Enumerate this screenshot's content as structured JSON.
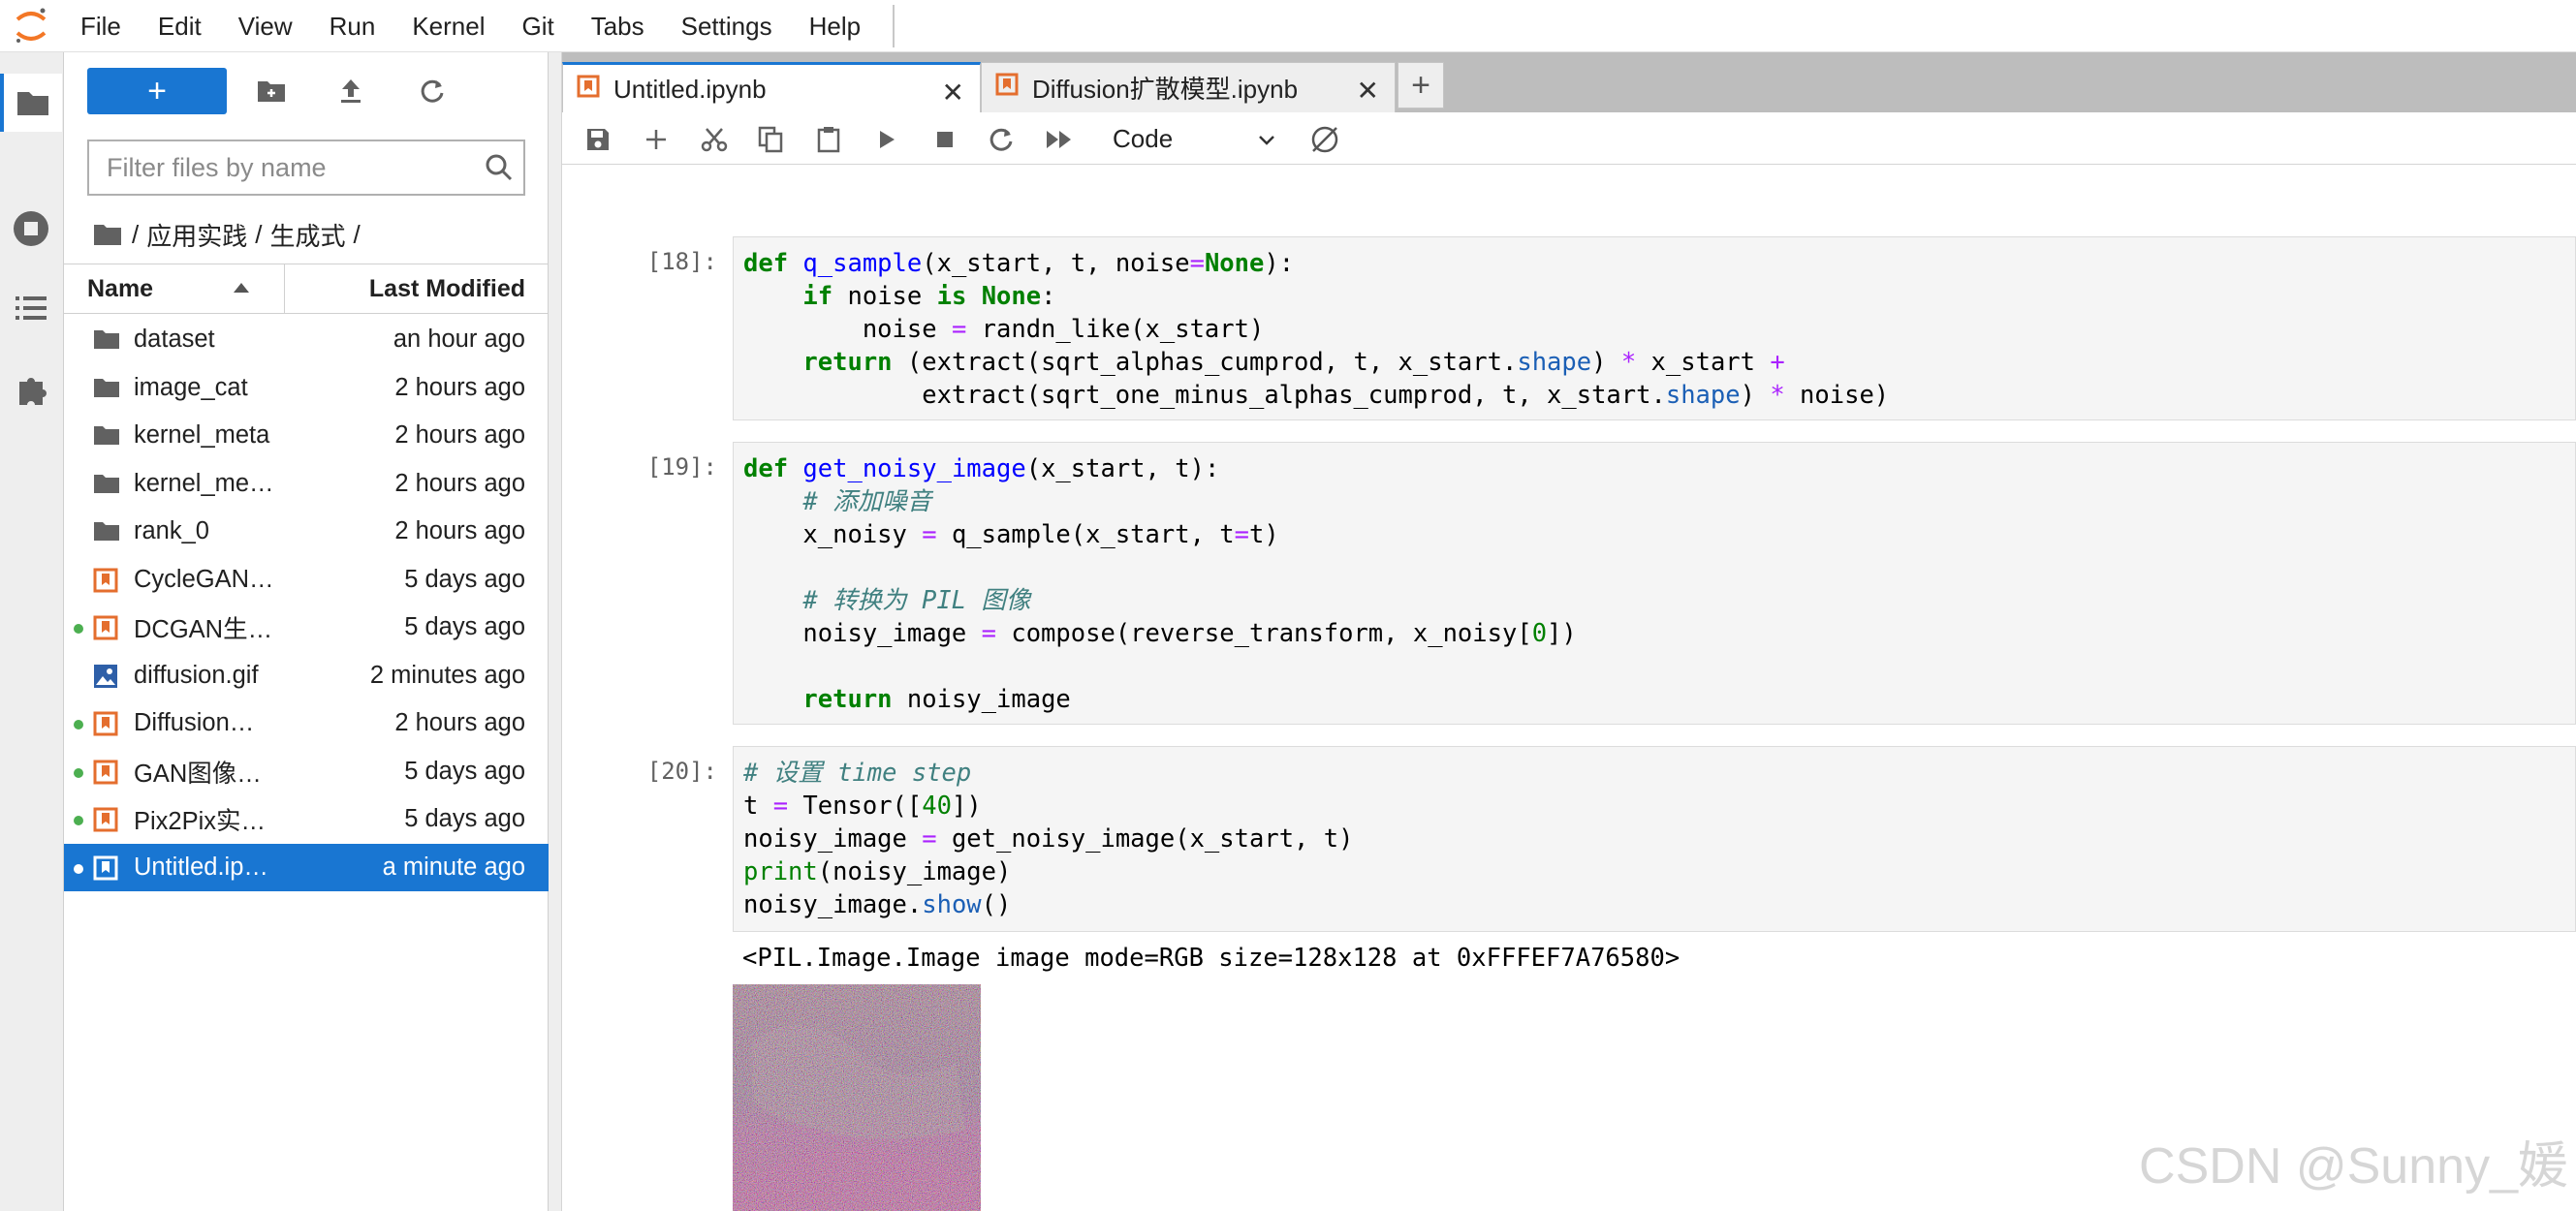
{
  "menubar": {
    "items": [
      "File",
      "Edit",
      "View",
      "Run",
      "Kernel",
      "Git",
      "Tabs",
      "Settings",
      "Help"
    ]
  },
  "activity_bar": {
    "icons": [
      "folder-icon",
      "running-icon",
      "toc-icon",
      "extension-icon"
    ]
  },
  "filebrowser": {
    "new_label": "+",
    "filter_placeholder": "Filter files by name",
    "filter_value": "",
    "breadcrumb": [
      "/",
      "应用实践",
      "/",
      "生成式",
      "/"
    ],
    "columns": {
      "name": "Name",
      "modified": "Last Modified"
    },
    "files": [
      {
        "name": "dataset",
        "modified": "an hour ago",
        "type": "folder",
        "running": false,
        "selected": false
      },
      {
        "name": "image_cat",
        "modified": "2 hours ago",
        "type": "folder",
        "running": false,
        "selected": false
      },
      {
        "name": "kernel_meta",
        "modified": "2 hours ago",
        "type": "folder",
        "running": false,
        "selected": false
      },
      {
        "name": "kernel_me…",
        "modified": "2 hours ago",
        "type": "folder",
        "running": false,
        "selected": false
      },
      {
        "name": "rank_0",
        "modified": "2 hours ago",
        "type": "folder",
        "running": false,
        "selected": false
      },
      {
        "name": "CycleGAN…",
        "modified": "5 days ago",
        "type": "notebook",
        "running": false,
        "selected": false
      },
      {
        "name": "DCGAN生…",
        "modified": "5 days ago",
        "type": "notebook",
        "running": true,
        "selected": false
      },
      {
        "name": "diffusion.gif",
        "modified": "2 minutes ago",
        "type": "image",
        "running": false,
        "selected": false
      },
      {
        "name": "Diffusion…",
        "modified": "2 hours ago",
        "type": "notebook",
        "running": true,
        "selected": false
      },
      {
        "name": "GAN图像…",
        "modified": "5 days ago",
        "type": "notebook",
        "running": true,
        "selected": false
      },
      {
        "name": "Pix2Pix实…",
        "modified": "5 days ago",
        "type": "notebook",
        "running": true,
        "selected": false
      },
      {
        "name": "Untitled.ip…",
        "modified": "a minute ago",
        "type": "notebook",
        "running": true,
        "selected": true
      }
    ]
  },
  "tabs": [
    {
      "label": "Untitled.ipynb",
      "active": true
    },
    {
      "label": "Diffusion扩散模型.ipynb",
      "active": false
    }
  ],
  "toolbar": {
    "cell_type": "Code",
    "buttons": [
      "save-icon",
      "add-cell-icon",
      "cut-icon",
      "copy-icon",
      "paste-icon",
      "run-icon",
      "stop-icon",
      "restart-icon",
      "fast-forward-icon"
    ]
  },
  "cells": [
    {
      "prompt": "[18]:",
      "lines": [
        "def q_sample(x_start, t, noise=None):",
        "    if noise is None:",
        "        noise = randn_like(x_start)",
        "    return (extract(sqrt_alphas_cumprod, t, x_start.shape) * x_start +",
        "            extract(sqrt_one_minus_alphas_cumprod, t, x_start.shape) * noise)"
      ]
    },
    {
      "prompt": "[19]:",
      "lines": [
        "def get_noisy_image(x_start, t):",
        "    # 添加噪音",
        "    x_noisy = q_sample(x_start, t=t)",
        "",
        "    # 转换为 PIL 图像",
        "    noisy_image = compose(reverse_transform, x_noisy[0])",
        "",
        "    return noisy_image"
      ]
    },
    {
      "prompt": "[20]:",
      "lines": [
        "# 设置 time step",
        "t = Tensor([40])",
        "noisy_image = get_noisy_image(x_start, t)",
        "print(noisy_image)",
        "noisy_image.show()"
      ],
      "output_text": "<PIL.Image.Image image mode=RGB size=128x128 at 0xFFFEF7A76580>"
    }
  ],
  "watermark": "CSDN @Sunny_媛",
  "colors": {
    "accent": "#1976d2",
    "running_dot": "#4caf50",
    "notebook_icon": "#e46e2e",
    "image_icon": "#2e5fa8"
  }
}
